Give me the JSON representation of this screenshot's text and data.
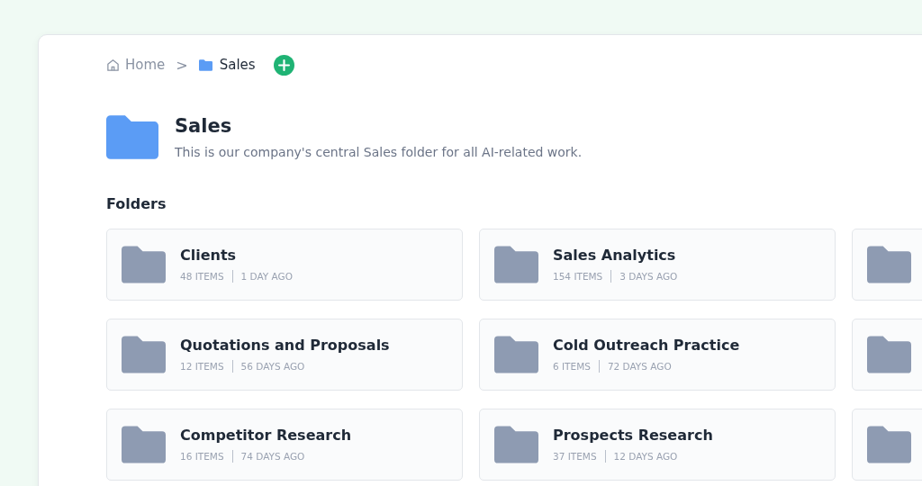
{
  "breadcrumb": {
    "home": "Home",
    "separator": ">",
    "current": "Sales"
  },
  "folder": {
    "title": "Sales",
    "description": "This is our company's central Sales folder for all AI-related work."
  },
  "section_title": "Folders",
  "rows": [
    {
      "cards": [
        {
          "kind": "full",
          "name": "Clients",
          "items": "48 ITEMS",
          "updated": "1 DAY AGO"
        },
        {
          "kind": "full",
          "name": "Sales Analytics",
          "items": "154 ITEMS",
          "updated": "3 DAYS AGO"
        },
        {
          "kind": "cut"
        }
      ]
    },
    {
      "cards": [
        {
          "kind": "full",
          "name": "Quotations and Proposals",
          "items": "12 ITEMS",
          "updated": "56 DAYS AGO"
        },
        {
          "kind": "full",
          "name": "Cold Outreach Practice",
          "items": "6 ITEMS",
          "updated": "72 DAYS AGO"
        },
        {
          "kind": "cut"
        }
      ]
    },
    {
      "cards": [
        {
          "kind": "full",
          "name": "Competitor Research",
          "items": "16 ITEMS",
          "updated": "74 DAYS AGO"
        },
        {
          "kind": "full",
          "name": "Prospects Research",
          "items": "37 ITEMS",
          "updated": "12 DAYS AGO"
        },
        {
          "kind": "cut"
        }
      ]
    }
  ]
}
